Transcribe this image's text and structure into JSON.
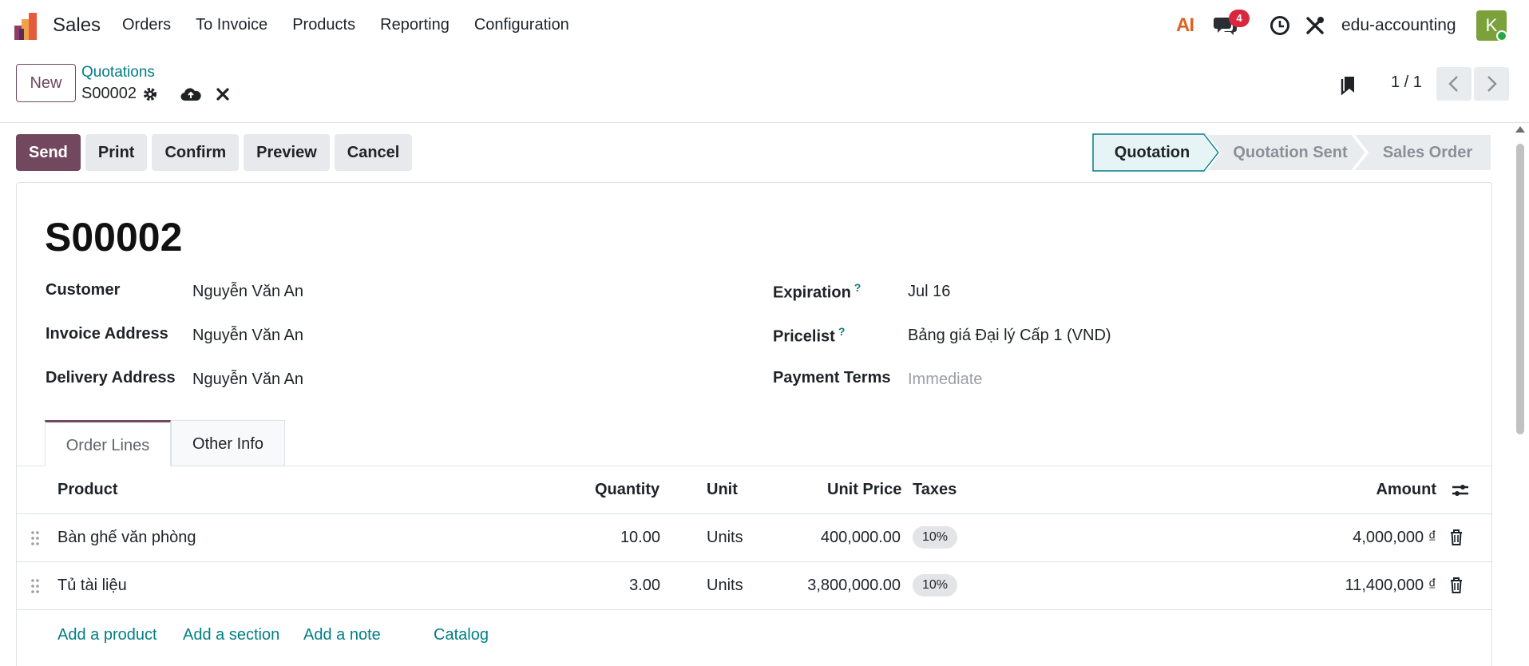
{
  "navbar": {
    "app_name": "Sales",
    "menu": [
      "Orders",
      "To Invoice",
      "Products",
      "Reporting",
      "Configuration"
    ],
    "ai_label": "AI",
    "chat_count": "4",
    "company": "edu-accounting",
    "avatar_initial": "K"
  },
  "control": {
    "new_label": "New",
    "breadcrumb_parent": "Quotations",
    "breadcrumb_current": "S00002",
    "pager": "1 / 1"
  },
  "actions": {
    "send": "Send",
    "print": "Print",
    "confirm": "Confirm",
    "preview": "Preview",
    "cancel": "Cancel"
  },
  "statusbar": {
    "stages": [
      "Quotation",
      "Quotation Sent",
      "Sales Order"
    ],
    "active": "Quotation"
  },
  "form": {
    "title": "S00002",
    "customer_label": "Customer",
    "customer": "Nguyễn Văn An",
    "invoice_address_label": "Invoice Address",
    "invoice_address": "Nguyễn Văn An",
    "delivery_address_label": "Delivery Address",
    "delivery_address": "Nguyễn Văn An",
    "expiration_label": "Expiration",
    "expiration": "Jul 16",
    "pricelist_label": "Pricelist",
    "pricelist": "Bảng giá Đại lý Cấp 1 (VND)",
    "payment_terms_label": "Payment Terms",
    "payment_terms_placeholder": "Immediate",
    "help_mark": "?"
  },
  "tabs": [
    "Order Lines",
    "Other Info"
  ],
  "table": {
    "headers": {
      "product": "Product",
      "quantity": "Quantity",
      "unit": "Unit",
      "unit_price": "Unit Price",
      "taxes": "Taxes",
      "amount": "Amount"
    },
    "rows": [
      {
        "product": "Bàn ghế văn phòng",
        "quantity": "10.00",
        "unit": "Units",
        "unit_price": "400,000.00",
        "tax": "10%",
        "amount": "4,000,000 ₫"
      },
      {
        "product": "Tủ tài liệu",
        "quantity": "3.00",
        "unit": "Units",
        "unit_price": "3,800,000.00",
        "tax": "10%",
        "amount": "11,400,000 ₫"
      }
    ],
    "add_links": {
      "add_product": "Add a product",
      "add_section": "Add a section",
      "add_note": "Add a note",
      "catalog": "Catalog"
    }
  },
  "colors": {
    "primary": "#71485e",
    "link": "#017e84",
    "badge": "#d9273d",
    "annotation_arrow": "#e02424"
  }
}
